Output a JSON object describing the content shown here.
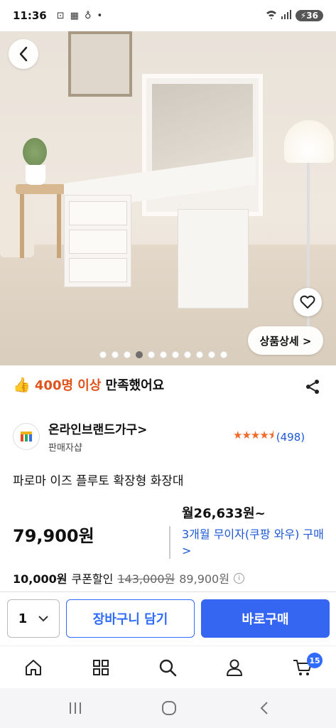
{
  "status_bar": {
    "time": "11:36",
    "battery": "36"
  },
  "hero": {
    "back_label": "‹",
    "detail_button": "상품상세 >",
    "dot_count": 11,
    "active_dot_index": 3
  },
  "satisfaction": {
    "count_text": "400명 이상",
    "suffix": "만족했어요"
  },
  "seller": {
    "name": "온라인브랜드가구>",
    "subtitle": "판매자샵",
    "rating_stars": 4.5,
    "review_count": "(498)"
  },
  "product": {
    "title": "파로마 이즈 플루토 확장형 화장대",
    "price": "79,900원"
  },
  "installment": {
    "monthly": "월26,633원~",
    "link_text": "3개월 무이자(쿠팡 와우) 구매 >"
  },
  "coupon": {
    "amount": "10,000원",
    "label": "쿠폰할인",
    "original_price": "143,000원",
    "final_price": "89,900원",
    "info_icon": "ⓘ"
  },
  "action_bar": {
    "quantity": "1",
    "cart_button": "장바구니 담기",
    "buy_button": "바로구매"
  },
  "tab_bar": {
    "cart_badge": "15"
  },
  "colors": {
    "accent_blue": "#3566f2",
    "orange": "#e0531b",
    "star": "#f06a2a",
    "link": "#1d58d6"
  }
}
